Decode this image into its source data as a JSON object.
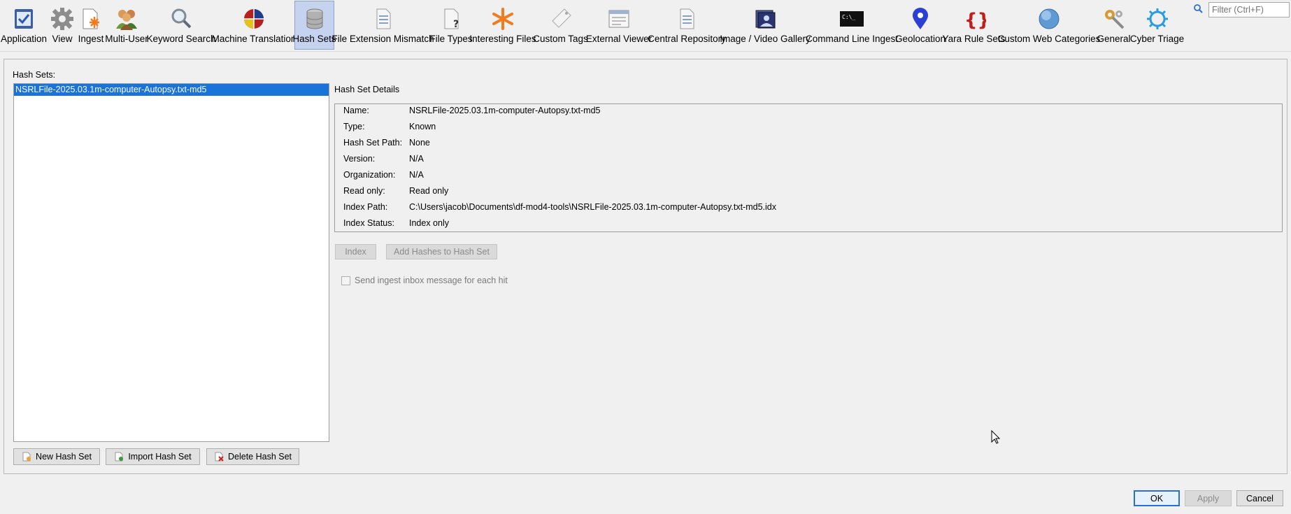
{
  "toolbar": {
    "items": [
      {
        "label": "Application",
        "icon": "application-icon"
      },
      {
        "label": "View",
        "icon": "gear-icon"
      },
      {
        "label": "Ingest",
        "icon": "ingest-icon"
      },
      {
        "label": "Multi-User",
        "icon": "users-icon"
      },
      {
        "label": "Keyword Search",
        "icon": "magnifier-icon"
      },
      {
        "label": "Machine Translation",
        "icon": "translation-icon"
      },
      {
        "label": "Hash Sets",
        "icon": "database-icon"
      },
      {
        "label": "File Extension Mismatch",
        "icon": "document-icon"
      },
      {
        "label": "File Types",
        "icon": "file-question-icon"
      },
      {
        "label": "Interesting Files",
        "icon": "asterisk-icon"
      },
      {
        "label": "Custom Tags",
        "icon": "tag-icon"
      },
      {
        "label": "External Viewer",
        "icon": "window-icon"
      },
      {
        "label": "Central Repository",
        "icon": "document-icon"
      },
      {
        "label": "Image / Video Gallery",
        "icon": "gallery-icon"
      },
      {
        "label": "Command Line Ingest",
        "icon": "terminal-icon"
      },
      {
        "label": "Geolocation",
        "icon": "map-pin-icon"
      },
      {
        "label": "Yara Rule Sets",
        "icon": "braces-icon"
      },
      {
        "label": "Custom Web Categories",
        "icon": "globe-icon"
      },
      {
        "label": "General",
        "icon": "tools-icon"
      },
      {
        "label": "Cyber Triage",
        "icon": "cyber-triage-icon"
      }
    ],
    "selected": "Hash Sets",
    "filter_placeholder": "Filter (Ctrl+F)",
    "terminal_icon_text": "C:\\_"
  },
  "hash_sets": {
    "title": "Hash Sets:",
    "items": [
      "NSRLFile-2025.03.1m-computer-Autopsy.txt-md5"
    ],
    "buttons": {
      "new": "New Hash Set",
      "import": "Import Hash Set",
      "delete": "Delete Hash Set"
    }
  },
  "details": {
    "title": "Hash Set Details",
    "rows": [
      {
        "label": "Name:",
        "value": "NSRLFile-2025.03.1m-computer-Autopsy.txt-md5"
      },
      {
        "label": "Type:",
        "value": "Known"
      },
      {
        "label": "Hash Set Path:",
        "value": "None"
      },
      {
        "label": "Version:",
        "value": "N/A"
      },
      {
        "label": "Organization:",
        "value": "N/A"
      },
      {
        "label": "Read only:",
        "value": "Read only"
      },
      {
        "label": "Index Path:",
        "value": "C:\\Users\\jacob\\Documents\\df-mod4-tools\\NSRLFile-2025.03.1m-computer-Autopsy.txt-md5.idx"
      },
      {
        "label": "Index Status:",
        "value": "Index only"
      }
    ],
    "index_button": "Index",
    "add_hashes_button": "Add Hashes to Hash Set",
    "send_ingest_checkbox": "Send ingest inbox message for each hit",
    "send_ingest_checked": false
  },
  "dialog_buttons": {
    "ok": "OK",
    "apply": "Apply",
    "cancel": "Cancel"
  },
  "colors": {
    "selection": "#1a73d9",
    "selected_tab": "#c6d3ee",
    "accent_orange": "#f07c1e"
  }
}
